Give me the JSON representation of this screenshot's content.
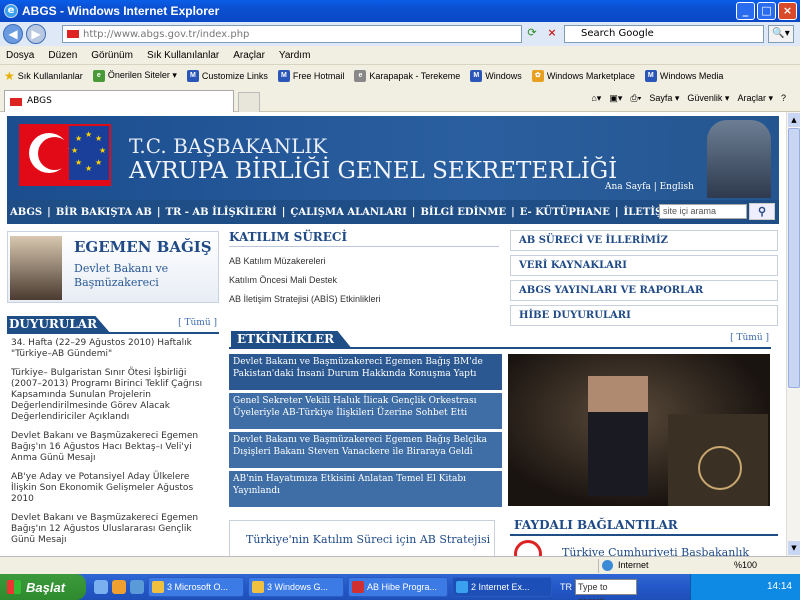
{
  "window": {
    "title": "ABGS - Windows Internet Explorer",
    "icon": "ie-icon"
  },
  "address": {
    "url": "http://www.abgs.gov.tr/index.php",
    "search_placeholder": "Search Google"
  },
  "menu": [
    "Dosya",
    "Düzen",
    "Görünüm",
    "Sık Kullanılanlar",
    "Araçlar",
    "Yardım"
  ],
  "favorites": [
    "Sık Kullanılanlar",
    "Önerilen Siteler ▾",
    "Customize Links",
    "Free Hotmail",
    "Karapapak - Terekeme",
    "Windows",
    "Windows Marketplace",
    "Windows Media"
  ],
  "tab": {
    "label": "ABGS"
  },
  "tools": [
    "Sayfa ▾",
    "Güvenlik ▾",
    "Araçlar ▾",
    "?"
  ],
  "banner": {
    "line1": "T.C. BAŞBAKANLIK",
    "line2": "AVRUPA BİRLİĞİ GENEL SEKRETERLİĞİ",
    "links": "Ana Sayfa | English"
  },
  "nav": {
    "items": [
      "ABGS",
      "BİR BAKIŞTA AB",
      "TR - AB İLİŞKİLERİ",
      "ÇALIŞMA ALANLARI",
      "BİLGİ EDİNME",
      "E- KÜTÜPHANE",
      "İLETİŞİM"
    ],
    "search_placeholder": "site içi arama"
  },
  "minister": {
    "name": "EGEMEN BAĞIŞ",
    "title": "Devlet Bakanı ve Başmüzakereci"
  },
  "duyurular": {
    "title": "DUYURULAR",
    "all": "[ Tümü ]",
    "items": [
      "34. Hafta (22–29 Ağustos 2010) Haftalık \"Türkiye–AB Gündemi\"",
      "Türkiye– Bulgaristan Sınır Ötesi İşbirliği (2007–2013) Programı Birinci Teklif Çağrısı Kapsamında Sunulan Projelerin Değerlendirilmesinde Görev Alacak Değerlendiriciler Açıklandı",
      "Devlet Bakanı ve Başmüzakereci Egemen Bağış'ın 16 Ağustos Hacı Bektaş–ı Veli'yi Anma Günü Mesajı",
      "AB'ye Aday ve Potansiyel Aday Ülkelere İlişkin Son Ekonomik Gelişmeler Ağustos 2010",
      "Devlet Bakanı ve Başmüzakereci Egemen Bağış'ın 12 Ağustos Uluslararası Gençlik Günü Mesajı"
    ]
  },
  "katilim": {
    "title": "KATILIM SÜRECİ",
    "items": [
      "AB Katılım Müzakereleri",
      "Katılım Öncesi Mali Destek",
      "AB İletişim Stratejisi (ABİS) Etkinlikleri"
    ]
  },
  "right_links": [
    "AB SÜRECİ VE İLLERİMİZ",
    "VERİ KAYNAKLARI",
    "ABGS YAYINLARI VE RAPORLAR",
    "HİBE DUYURULARI"
  ],
  "etkinlikler": {
    "title": "ETKİNLİKLER",
    "all": "[ Tümü ]",
    "items": [
      "Devlet Bakanı ve Başmüzakereci Egemen Bağış BM'de Pakistan'daki İnsani Durum Hakkında Konuşma Yaptı",
      "Genel Sekreter Vekili Haluk İlicak Gençlik Orkestrası Üyeleriyle AB-Türkiye İlişkileri Üzerine Sohbet Etti",
      "Devlet Bakanı ve Başmüzakereci Egemen Bağış Belçika Dışişleri Bakanı Steven Vanackere ile Biraraya Geldi",
      "AB'nin Hayatımıza Etkisini Anlatan Temel El Kitabı Yayınlandı"
    ]
  },
  "strategy": "Türkiye'nin Katılım Süreci için AB Stratejisi",
  "faydali": {
    "title": "FAYDALI BAĞLANTILAR",
    "first": "Türkiye Cumhuriyeti Başbakanlık"
  },
  "status": {
    "zone": "Internet",
    "zoom": "%100"
  },
  "taskbar": {
    "start": "Başlat",
    "buttons": [
      "3 Microsoft O...",
      "3 Windows G...",
      "AB Hibe Progra...",
      "2 Internet Ex..."
    ],
    "lang": "TR",
    "search": "Type to search",
    "time": "14:14"
  }
}
